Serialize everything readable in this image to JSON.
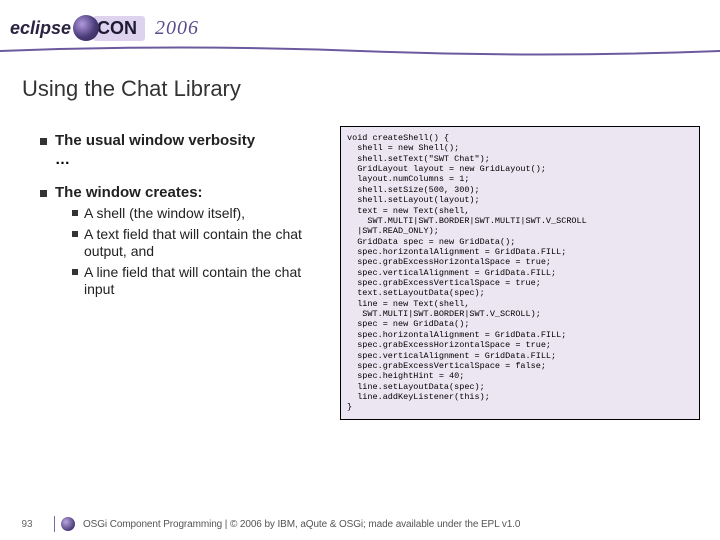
{
  "header": {
    "logo_left": "eclipse",
    "logo_right": "CON",
    "year": "2006"
  },
  "title": "Using the Chat Library",
  "left": {
    "b1": "The usual window verbosity",
    "b1_cont": "…",
    "b2": "The window creates:",
    "sub": [
      "A shell (the window itself),",
      "A text field that will contain the chat output, and",
      "A line field that will contain the chat input"
    ]
  },
  "code": "void createShell() {\n  shell = new Shell();\n  shell.setText(\"SWT Chat\");\n  GridLayout layout = new GridLayout();\n  layout.numColumns = 1;\n  shell.setSize(500, 300);\n  shell.setLayout(layout);\n  text = new Text(shell,\n    SWT.MULTI|SWT.BORDER|SWT.MULTI|SWT.V_SCROLL\n  |SWT.READ_ONLY);\n  GridData spec = new GridData();\n  spec.horizontalAlignment = GridData.FILL;\n  spec.grabExcessHorizontalSpace = true;\n  spec.verticalAlignment = GridData.FILL;\n  spec.grabExcessVerticalSpace = true;\n  text.setLayoutData(spec);\n  line = new Text(shell,\n   SWT.MULTI|SWT.BORDER|SWT.V_SCROLL);\n  spec = new GridData();\n  spec.horizontalAlignment = GridData.FILL;\n  spec.grabExcessHorizontalSpace = true;\n  spec.verticalAlignment = GridData.FILL;\n  spec.grabExcessVerticalSpace = false;\n  spec.heightHint = 40;\n  line.setLayoutData(spec);\n  line.addKeyListener(this);\n}",
  "footer": {
    "page": "93",
    "copyright": "OSGi Component Programming | © 2006 by IBM, aQute & OSGi; made available under the EPL v1.0"
  }
}
